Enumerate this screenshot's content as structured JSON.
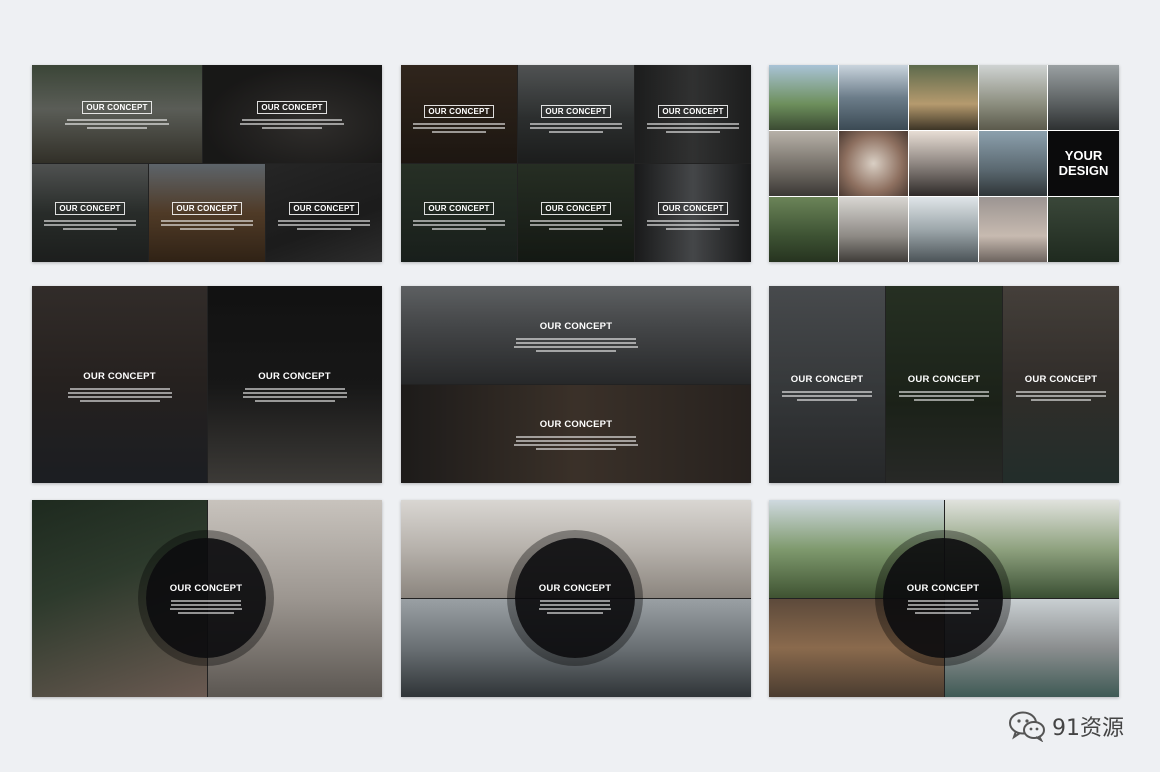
{
  "concept_label": "OUR CONCEPT",
  "your_design": [
    "YOUR",
    "DESIGN"
  ],
  "watermark": "91资源",
  "icons": {
    "watermark": "wechat-icon"
  },
  "colors": {
    "background": "#eef0f3",
    "circle": "#0c0c0e"
  },
  "slides": [
    {
      "id": "slide-1",
      "layout": "2 top, 3 bottom photo grid",
      "concept_count": 5
    },
    {
      "id": "slide-2",
      "layout": "3x2 photo grid",
      "concept_count": 6
    },
    {
      "id": "slide-3",
      "layout": "5x3 photo collage with YOUR DESIGN tile",
      "concept_count": 0
    },
    {
      "id": "slide-4",
      "layout": "2 columns",
      "concept_count": 2
    },
    {
      "id": "slide-5",
      "layout": "2 rows",
      "concept_count": 2
    },
    {
      "id": "slide-6",
      "layout": "3 columns",
      "concept_count": 3
    },
    {
      "id": "slide-7",
      "layout": "2 columns with center circle",
      "concept_count": 1
    },
    {
      "id": "slide-8",
      "layout": "2 rows with center circle",
      "concept_count": 1
    },
    {
      "id": "slide-9",
      "layout": "2x2 grid with center circle",
      "concept_count": 1
    }
  ]
}
